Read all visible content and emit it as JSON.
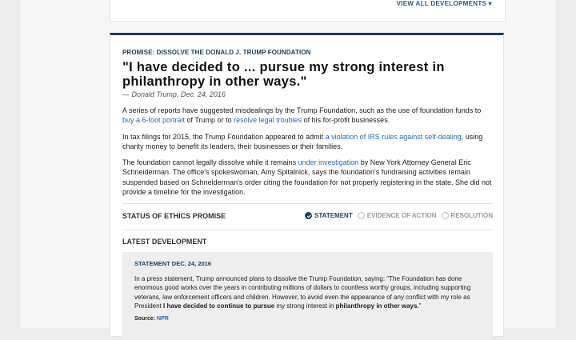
{
  "prev_card": {
    "view_all": "VIEW ALL DEVELOPMENTS ▾"
  },
  "promise": {
    "kicker": "PROMISE: DISSOLVE THE DONALD J. TRUMP FOUNDATION",
    "quote": "\"I have decided to ... pursue my strong interest in philanthropy in other ways.\"",
    "attribution": "— Donald Trump, Dec. 24, 2016",
    "paragraphs": [
      {
        "pre": "A series of reports have suggested misdealings by the Trump Foundation, such as the use of foundation funds to ",
        "link1": "buy a 6-foot portrait",
        "mid": " of Trump or to ",
        "link2": "resolve legal troubles",
        "post": " of his for-profit businesses."
      },
      {
        "pre": "In tax filings for 2015, the Trump Foundation appeared to admit ",
        "link1": "a violation of IRS rules against self-dealing",
        "post": ", using charity money to benefit its leaders, their businesses or their families."
      },
      {
        "pre": "The foundation cannot legally dissolve while it remains ",
        "link1": "under investigation",
        "post": " by New York Attorney General Eric Schneiderman. The office's spokeswoman, Amy Spitalnick, says the foundation's fundraising activities remain suspended based on Schneiderman's order citing the foundation for not properly registering in the state. She did not provide a timeline for the investigation."
      }
    ]
  },
  "status": {
    "title": "STATUS OF ETHICS PROMISE",
    "steps": [
      {
        "label": "STATEMENT",
        "active": true
      },
      {
        "label": "EVIDENCE OF ACTION",
        "active": false
      },
      {
        "label": "RESOLUTION",
        "active": false
      }
    ]
  },
  "latest": {
    "title": "LATEST DEVELOPMENT",
    "kicker": "STATEMENT DEC. 24, 2016",
    "text_pre": "In a press statement, Trump announced plans to dissolve the Trump Foundation, saying: \"The Foundation has done enormous good works over the years in contributing millions of dollars to countless worthy groups, including supporting veterans, law enforcement officers and children. However, to avoid even the appearance of any conflict with my role as President ",
    "text_bold1": "I have decided to continue to pursue",
    "text_mid": " my strong interest in ",
    "text_bold2": "philanthropy in other ways.",
    "text_post": "\"",
    "source_label": "Source: ",
    "source_link": "NPR"
  },
  "colors": {
    "accent": "#1e3f5a",
    "link": "#2a6bb0",
    "panel": "#eeeeee"
  }
}
